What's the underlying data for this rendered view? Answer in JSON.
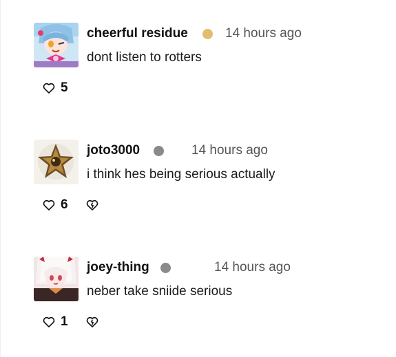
{
  "comments": [
    {
      "username": "cheerful residue",
      "status_color": "#e2bd6e",
      "timestamp": "14 hours ago",
      "body": "dont listen to rotters",
      "likes": "5",
      "avatar_icon": "anime-avatar-icon"
    },
    {
      "username": "joto3000",
      "status_color": "#8a8a8a",
      "timestamp": "14 hours ago",
      "body": "i think hes being serious actually",
      "likes": "6",
      "avatar_icon": "star-avatar-icon"
    },
    {
      "username": "joey-thing",
      "status_color": "#8a8a8a",
      "timestamp": "14 hours ago",
      "body": "neber take sniide serious",
      "likes": "1",
      "avatar_icon": "anime-girl-avatar-icon"
    }
  ],
  "icons": {
    "like": "heart-icon",
    "dislike": "broken-heart-icon"
  }
}
